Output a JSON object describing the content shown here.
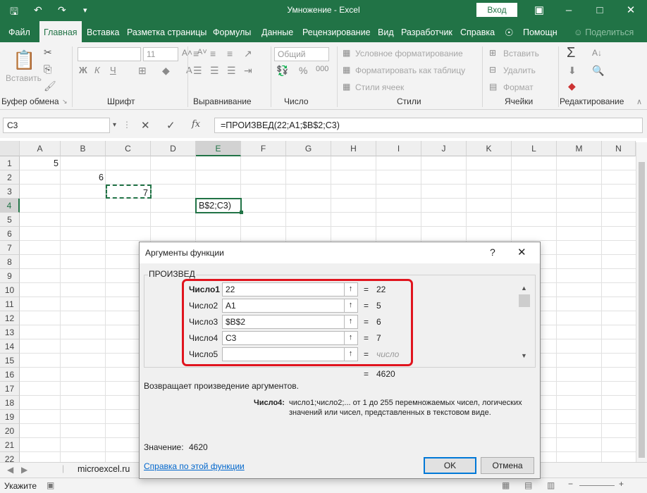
{
  "window": {
    "title": "Умножение  -  Excel",
    "login_button": "Вход",
    "share": "Поделиться"
  },
  "tabs": [
    "Файл",
    "Главная",
    "Вставка",
    "Разметка страницы",
    "Формулы",
    "Данные",
    "Рецензирование",
    "Вид",
    "Разработчик",
    "Справка",
    "Помощн"
  ],
  "ribbon": {
    "paste": "Вставить",
    "font_size": "11",
    "number_format": "Общий",
    "cond_format": "Условное форматирование",
    "format_table": "Форматировать как таблицу",
    "cell_styles": "Стили ячеек",
    "insert": "Вставить",
    "delete": "Удалить",
    "format": "Формат",
    "groups": {
      "clipboard": "Буфер обмена",
      "font": "Шрифт",
      "alignment": "Выравнивание",
      "number": "Число",
      "styles": "Стили",
      "cells": "Ячейки",
      "editing": "Редактирование"
    }
  },
  "formula_bar": {
    "name_box": "C3",
    "fx": "fx",
    "formula": "=ПРОИЗВЕД(22;A1;$B$2;C3)"
  },
  "grid": {
    "columns": [
      "A",
      "B",
      "C",
      "D",
      "E",
      "F",
      "G",
      "H",
      "I",
      "J",
      "K",
      "L",
      "M",
      "N"
    ],
    "rows": [
      "1",
      "2",
      "3",
      "4",
      "5",
      "6",
      "7",
      "8",
      "9",
      "10",
      "11",
      "12",
      "13",
      "14",
      "15",
      "16",
      "17",
      "18",
      "19",
      "20",
      "21",
      "22"
    ],
    "cells": {
      "A1": "5",
      "B2": "6",
      "C3": "7",
      "E4": "B$2;C3)"
    },
    "active_cell": "E4",
    "copy_range": "C3"
  },
  "sheet_tab": "microexcel.ru",
  "status": "Укажите",
  "dialog": {
    "title": "Аргументы функции",
    "help": "?",
    "function_name": "ПРОИЗВЕД",
    "args": [
      {
        "label": "Число1",
        "value": "22",
        "result": "22"
      },
      {
        "label": "Число2",
        "value": "A1",
        "result": "5"
      },
      {
        "label": "Число3",
        "value": "$B$2",
        "result": "6"
      },
      {
        "label": "Число4",
        "value": "C3",
        "result": "7"
      },
      {
        "label": "Число5",
        "value": "",
        "result": "число"
      }
    ],
    "total": "4620",
    "description": "Возвращает произведение аргументов.",
    "arg_help_label": "Число4:",
    "arg_help_text": "число1;число2;... от 1 до 255 перемножаемых чисел, логических значений или чисел, представленных в текстовом виде.",
    "value_label": "Значение:",
    "value": "4620",
    "help_link": "Справка по этой функции",
    "ok": "OK",
    "cancel": "Отмена"
  }
}
